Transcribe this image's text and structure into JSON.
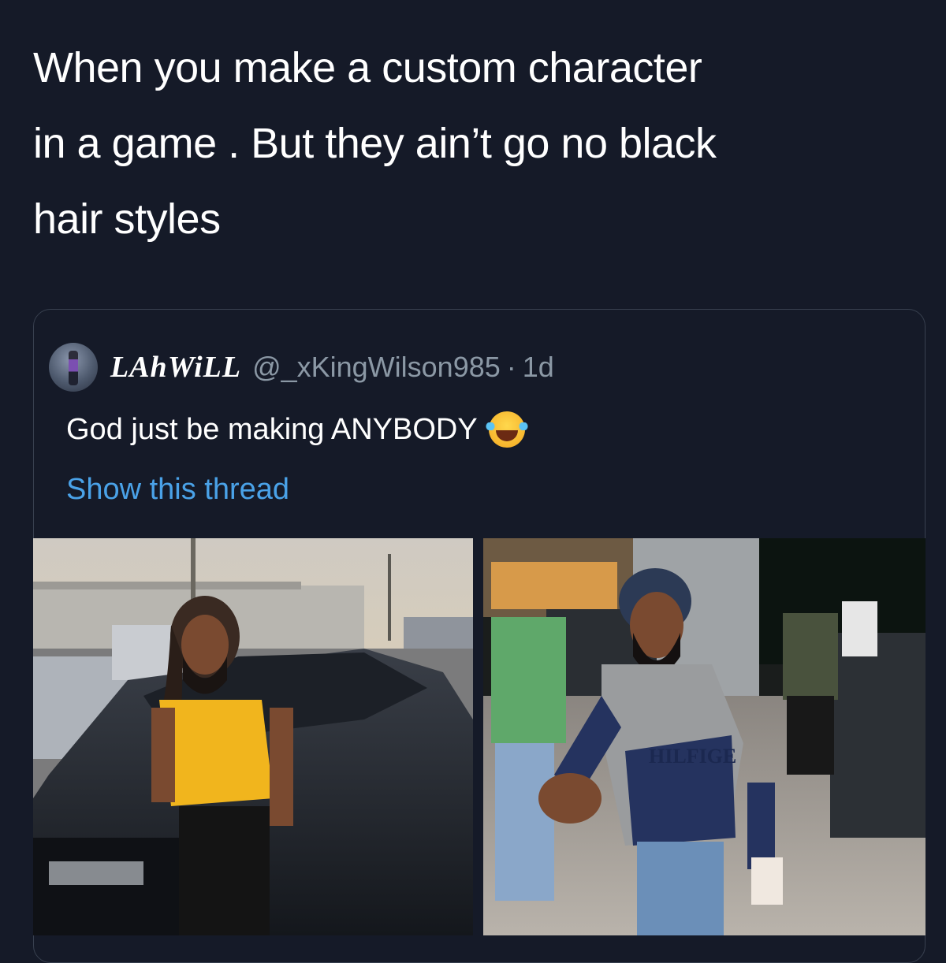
{
  "caption": {
    "line1": "When you make a  custom character",
    "line2": "in a game . But they ain’t go no black",
    "line3": "hair styles"
  },
  "quoted_tweet": {
    "display_name": "LAhWiLL",
    "handle": "@_xKingWilson985",
    "separator": "·",
    "time": "1d",
    "text": "God just be making ANYBODY",
    "emoji": "face-with-tears-of-joy",
    "show_thread": "Show this thread",
    "link_color": "#4aa2e8"
  },
  "photos": {
    "right_shirt_text": "HILFIGE"
  },
  "colors": {
    "background": "#151a28",
    "border": "#38404f",
    "muted_text": "#8b98a5"
  }
}
